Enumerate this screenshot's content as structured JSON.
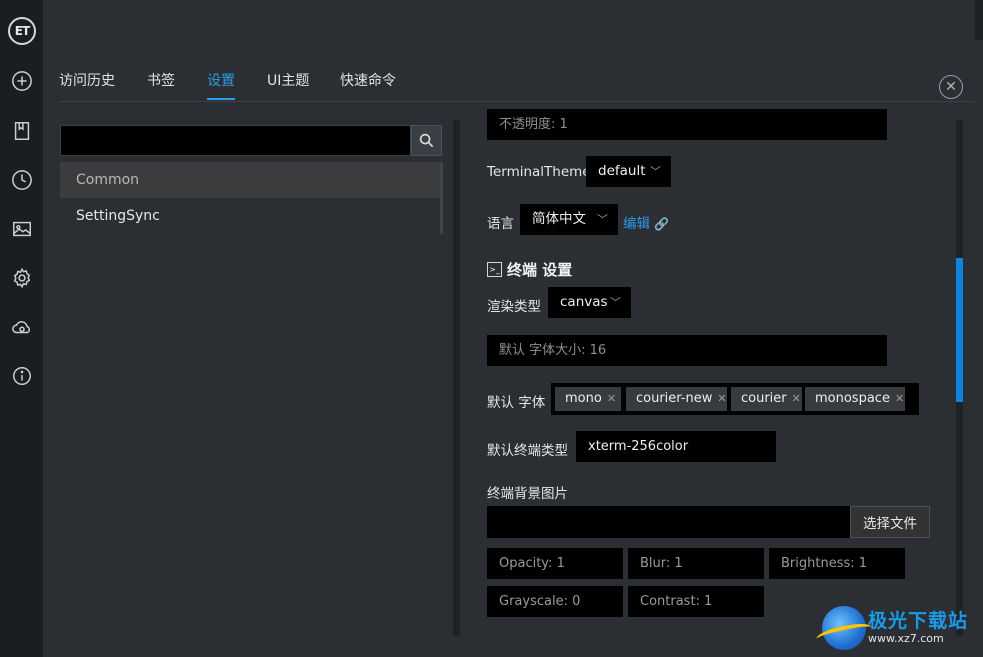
{
  "rail": {
    "logo_text": "ET",
    "icons": [
      "add-icon",
      "bookmark-icon",
      "history-icon",
      "image-icon",
      "gear-icon",
      "cloud-sync-icon",
      "info-icon"
    ]
  },
  "tabs": [
    {
      "label": "访问历史",
      "active": false
    },
    {
      "label": "书签",
      "active": false
    },
    {
      "label": "设置",
      "active": true
    },
    {
      "label": "UI主题",
      "active": false
    },
    {
      "label": "快速命令",
      "active": false
    }
  ],
  "sidebar": {
    "search_value": "",
    "items": [
      {
        "label": "Common",
        "selected": true
      },
      {
        "label": "SettingSync",
        "selected": false
      }
    ]
  },
  "settings": {
    "opacity_placeholder": "不透明度: 1",
    "terminal_theme_label": "TerminalTheme",
    "terminal_theme_value": "default",
    "language_label": "语言",
    "language_value": "简体中文",
    "edit_link": "编辑",
    "terminal_section_title": "终端 设置",
    "render_type_label": "渲染类型",
    "render_type_value": "canvas",
    "font_size_placeholder": "默认 字体大小: 16",
    "font_family_label": "默认 字体",
    "font_chips": [
      "mono",
      "courier-new",
      "courier",
      "monospace"
    ],
    "term_type_label": "默认终端类型",
    "term_type_value": "xterm-256color",
    "bg_image_label": "终端背景图片",
    "choose_file_label": "选择文件",
    "opacity_field": "Opacity: 1",
    "blur_field": "Blur: 1",
    "brightness_field": "Brightness: 1",
    "grayscale_field": "Grayscale: 0",
    "contrast_field": "Contrast: 1"
  },
  "watermark": {
    "title": "极光下载站",
    "url": "www.xz7.com"
  },
  "colors": {
    "accent": "#2b9bea",
    "rail_bg": "#1b1e21",
    "panel_bg": "#2b2f33",
    "scroll_thumb": "#0b86dc"
  }
}
